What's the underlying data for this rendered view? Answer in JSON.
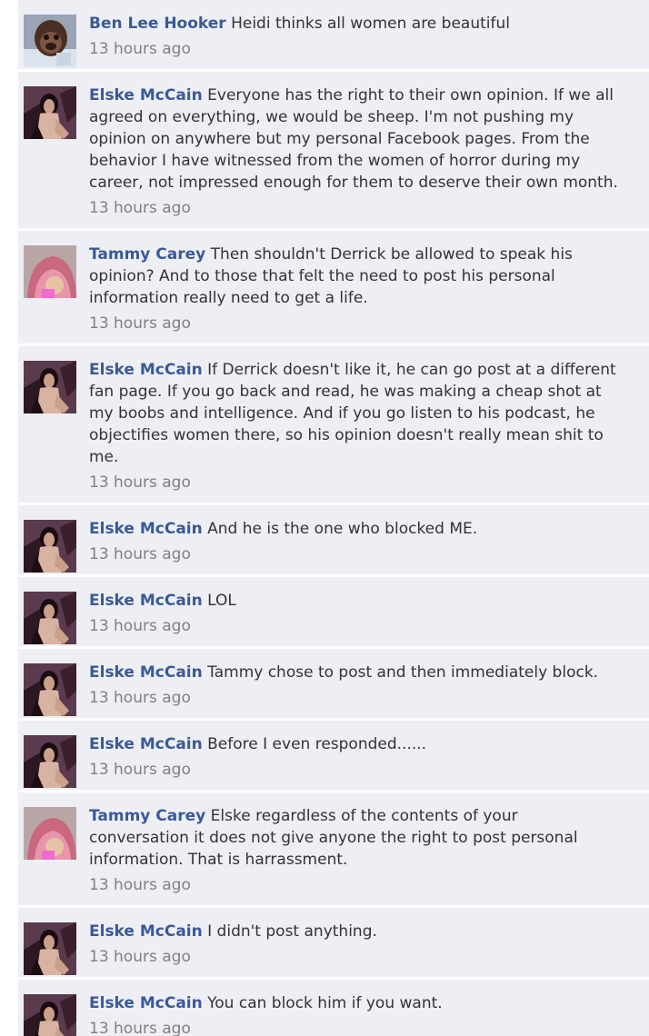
{
  "comments": [
    {
      "author": "Ben Lee Hooker",
      "text": "Heidi thinks all women are beautiful",
      "time": "13 hours ago",
      "avatar": "ben"
    },
    {
      "author": "Elske McCain",
      "text": "Everyone has the right to their own opinion. If we all agreed on everything, we would be sheep. I'm not pushing my opinion on anywhere but my personal Facebook pages. From the behavior I have witnessed from the women of horror during my career, not impressed enough for them to deserve their own month.",
      "time": "13 hours ago",
      "avatar": "elske"
    },
    {
      "author": "Tammy Carey",
      "text": "Then shouldn't Derrick be allowed to speak his opinion? And to those that felt the need to post his personal information really need to get a life.",
      "time": "13 hours ago",
      "avatar": "tammy"
    },
    {
      "author": "Elske McCain",
      "text": "If Derrick doesn't like it, he can go post at a different fan page. If you go back and read, he was making a cheap shot at my boobs and intelligence. And if you go listen to his podcast, he objectifies women there, so his opinion doesn't really mean shit to me.",
      "time": "13 hours ago",
      "avatar": "elske"
    },
    {
      "author": "Elske McCain",
      "text": "And he is the one who blocked ME.",
      "time": "13 hours ago",
      "avatar": "elske"
    },
    {
      "author": "Elske McCain",
      "text": "LOL",
      "time": "13 hours ago",
      "avatar": "elske"
    },
    {
      "author": "Elske McCain",
      "text": "Tammy chose to post and then immediately block.",
      "time": "13 hours ago",
      "avatar": "elske"
    },
    {
      "author": "Elske McCain",
      "text": "Before I even responded......",
      "time": "13 hours ago",
      "avatar": "elske"
    },
    {
      "author": "Tammy Carey",
      "text": "Elske regardless of the contents of your conversation it does not give anyone the right to post personal information. That is harrassment.",
      "time": "13 hours ago",
      "avatar": "tammy"
    },
    {
      "author": "Elske McCain",
      "text": "I didn't post anything.",
      "time": "13 hours ago",
      "avatar": "elske"
    },
    {
      "author": "Elske McCain",
      "text": "You can block him if you want.",
      "time": "13 hours ago",
      "avatar": "elske"
    }
  ],
  "colors": {
    "author": "#3b5998",
    "text": "#333333",
    "timestamp": "#808080",
    "background": "#edeff4"
  }
}
